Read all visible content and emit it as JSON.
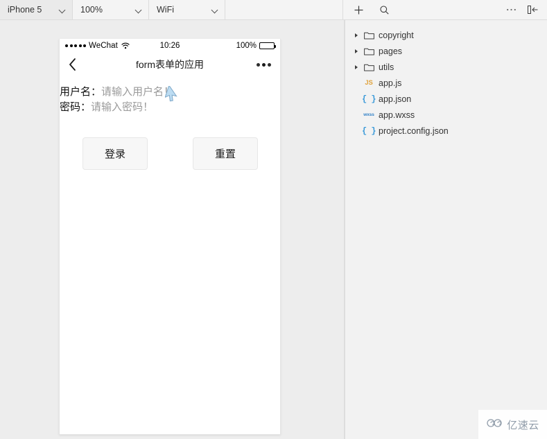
{
  "toolbar": {
    "device_select": {
      "value": "iPhone 5",
      "icon": "chevron-down-icon"
    },
    "zoom_select": {
      "value": "100%",
      "icon": "chevron-down-icon"
    },
    "network_select": {
      "value": "WiFi",
      "icon": "chevron-down-icon"
    },
    "add_icon": "plus-icon",
    "search_icon": "search-icon",
    "more_icon": "ellipsis-icon",
    "collapse_icon": "panel-collapse-icon"
  },
  "simulator": {
    "status_bar": {
      "signal_dots": 5,
      "carrier": "WeChat",
      "wifi_icon": "wifi-icon",
      "time": "10:26",
      "battery_percent": "100%",
      "battery_icon": "battery-full-icon"
    },
    "nav_bar": {
      "back_icon": "chevron-left-icon",
      "title": "form表单的应用",
      "more_icon": "three-dots-icon"
    },
    "form": {
      "username": {
        "label": "用户名：",
        "placeholder": "请输入用户名！",
        "value": ""
      },
      "password": {
        "label": "密码：",
        "placeholder": "请输入密码！",
        "value": ""
      },
      "submit_button": "登录",
      "reset_button": "重置"
    },
    "cursor_icon": "mouse-pointer-icon"
  },
  "file_tree": {
    "items": [
      {
        "name": "copyright",
        "type": "folder",
        "expanded": false,
        "icon": "folder-icon"
      },
      {
        "name": "pages",
        "type": "folder",
        "expanded": false,
        "icon": "folder-icon"
      },
      {
        "name": "utils",
        "type": "folder",
        "expanded": false,
        "icon": "folder-icon"
      },
      {
        "name": "app.js",
        "type": "file",
        "badge": "JS",
        "icon": "js-file-icon"
      },
      {
        "name": "app.json",
        "type": "file",
        "badge": "{ }",
        "icon": "json-file-icon"
      },
      {
        "name": "app.wxss",
        "type": "file",
        "badge": "wxss",
        "icon": "wxss-file-icon"
      },
      {
        "name": "project.config.json",
        "type": "file",
        "badge": "{ }",
        "icon": "json-file-icon"
      }
    ]
  },
  "watermark": {
    "text": "亿速云",
    "logo_icon": "cloud-logo-icon"
  },
  "colors": {
    "toolbar_bg": "#f4f4f4",
    "panel_bg": "#ededed",
    "files_bg": "#f2f2f2",
    "phone_bg": "#ffffff",
    "js_icon": "#e0a33e",
    "json_icon": "#3b9ad9",
    "wxss_icon": "#2f7fc6",
    "placeholder_text": "#9a9a9a",
    "label_text": "#111111",
    "watermark_text": "#8e9aa8"
  }
}
